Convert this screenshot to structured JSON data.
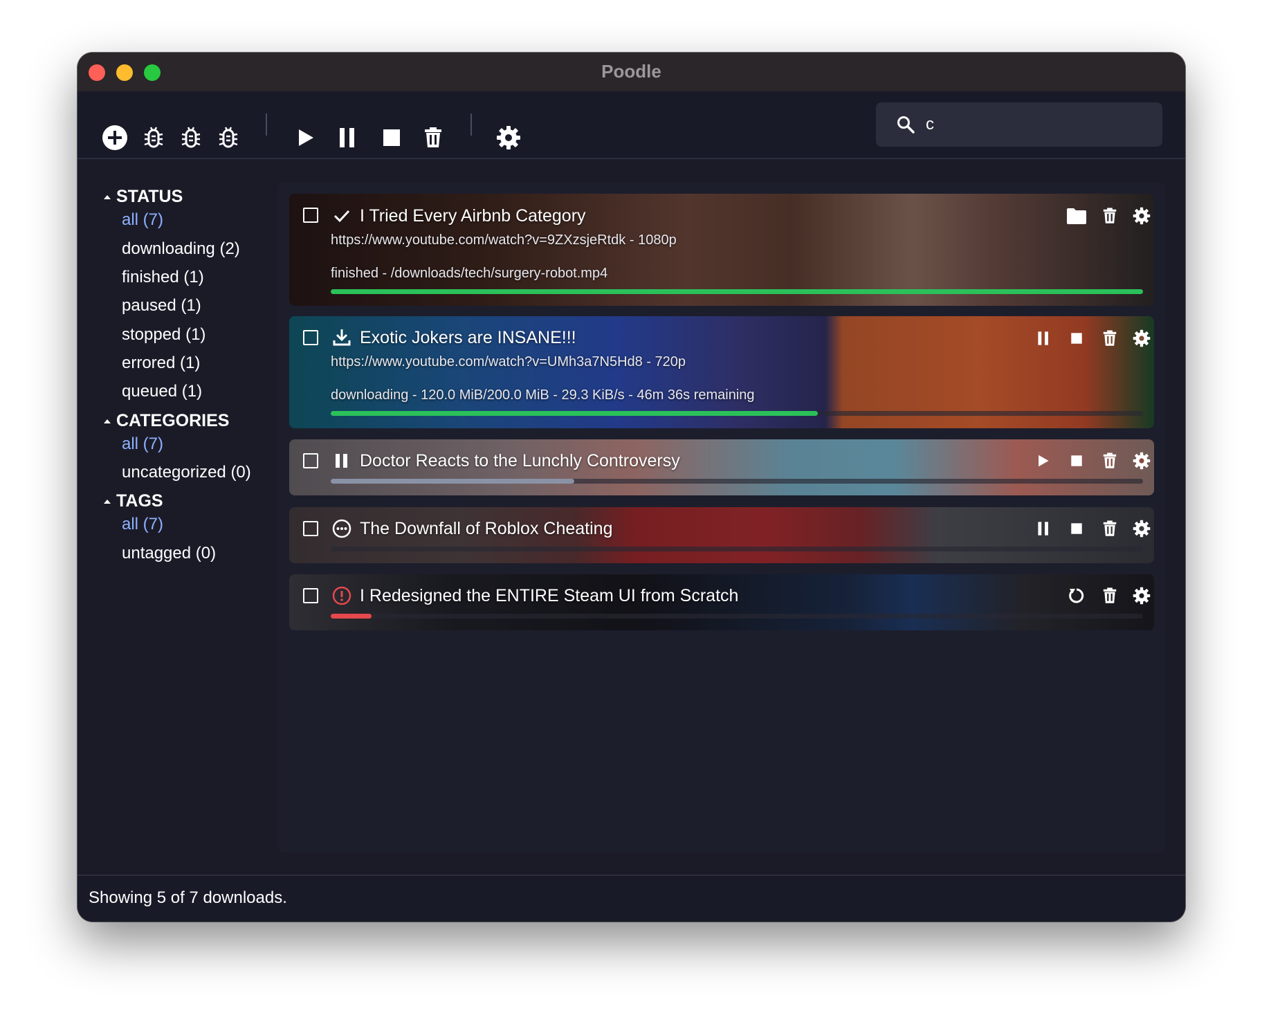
{
  "window": {
    "title": "Poodle"
  },
  "toolbar": {
    "buttons": [
      "add-icon",
      "bug-icon",
      "bug-icon",
      "bug-icon",
      "play-icon",
      "pause-icon",
      "stop-icon",
      "trash-icon",
      "gear-icon"
    ],
    "search_value": "c"
  },
  "sidebar": {
    "status_heading": "STATUS",
    "status_items": [
      {
        "label": "all (7)"
      },
      {
        "label": "downloading (2)"
      },
      {
        "label": "finished (1)"
      },
      {
        "label": "paused (1)"
      },
      {
        "label": "stopped (1)"
      },
      {
        "label": "errored (1)"
      },
      {
        "label": "queued (1)"
      }
    ],
    "categories_heading": "CATEGORIES",
    "category_items": [
      {
        "label": "all (7)"
      },
      {
        "label": "uncategorized (0)"
      }
    ],
    "tags_heading": "TAGS",
    "tag_items": [
      {
        "label": "all (7)"
      },
      {
        "label": "untagged (0)"
      }
    ]
  },
  "downloads": [
    {
      "title": "I Tried Every Airbnb Category",
      "url": "https://www.youtube.com/watch?v=9ZXzsjeRtdk - 1080p",
      "info": "finished - /downloads/tech/surgery-robot.mp4",
      "status_icon": "check-icon",
      "progress": 1.0,
      "bar_color": "#2bc15a"
    },
    {
      "title": "Exotic Jokers are INSANE!!!",
      "url": "https://www.youtube.com/watch?v=UMh3a7N5Hd8 - 720p",
      "info": "downloading - 120.0 MiB/200.0 MiB - 29.3 KiB/s - 46m 36s remaining",
      "status_icon": "download-icon",
      "progress": 0.6,
      "bar_color": "#2bc15a"
    },
    {
      "title": "Doctor Reacts to the Lunchly Controversy",
      "status_icon": "pause-icon",
      "progress": 0.3,
      "bar_color": "#8a92a6"
    },
    {
      "title": "The Downfall of Roblox Cheating",
      "status_icon": "queued-icon",
      "progress": 0.0,
      "bar_color": "#8a92a6"
    },
    {
      "title": "I Redesigned the ENTIRE Steam UI from Scratch",
      "status_icon": "error-icon",
      "progress": 0.05,
      "bar_color": "#e5484d"
    }
  ],
  "colors": {
    "accent_link": "#8fb2ff",
    "success": "#2bc15a",
    "error": "#e5484d"
  },
  "statusbar": {
    "text": "Showing 5 of 7 downloads."
  }
}
